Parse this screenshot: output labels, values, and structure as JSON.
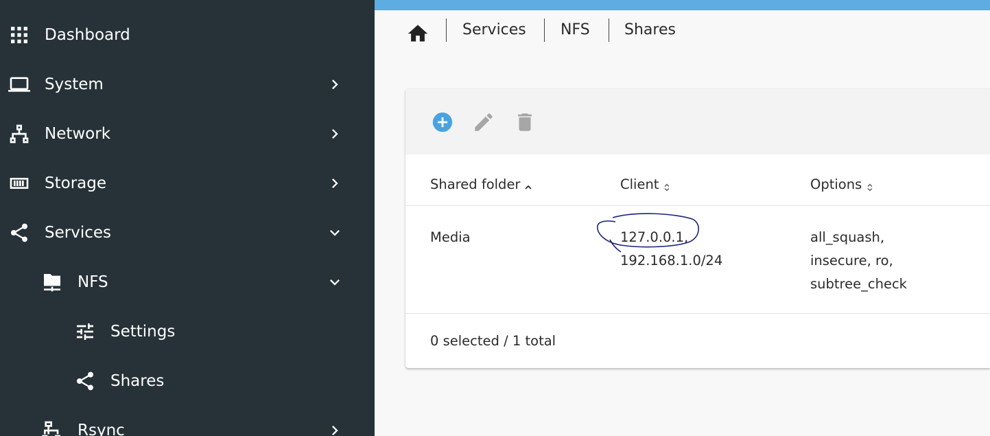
{
  "sidebar": {
    "items": [
      {
        "label": "Dashboard",
        "icon": "grid-icon"
      },
      {
        "label": "System",
        "icon": "laptop-icon"
      },
      {
        "label": "Network",
        "icon": "network-icon"
      },
      {
        "label": "Storage",
        "icon": "storage-icon"
      },
      {
        "label": "Services",
        "icon": "share-icon"
      },
      {
        "label": "NFS",
        "icon": "network-folder-icon"
      },
      {
        "label": "Settings",
        "icon": "tune-icon"
      },
      {
        "label": "Shares",
        "icon": "share-icon"
      },
      {
        "label": "Rsync",
        "icon": "rsync-icon"
      }
    ]
  },
  "breadcrumb": {
    "items": [
      "Services",
      "NFS",
      "Shares"
    ]
  },
  "toolbar": {
    "add": "add-circle-icon",
    "edit": "pencil-icon",
    "delete": "trash-icon"
  },
  "table": {
    "columns": [
      "Shared folder",
      "Client",
      "Options"
    ],
    "rows": [
      {
        "shared_folder": "Media",
        "client": [
          "127.0.0.1,",
          "192.168.1.0/24"
        ],
        "options": [
          "all_squash,",
          "insecure, ro,",
          "subtree_check"
        ]
      }
    ],
    "footer": "0 selected / 1 total"
  },
  "colors": {
    "sidebar_bg": "#263238",
    "accent": "#5dade2",
    "annotation": "#1a237e"
  }
}
